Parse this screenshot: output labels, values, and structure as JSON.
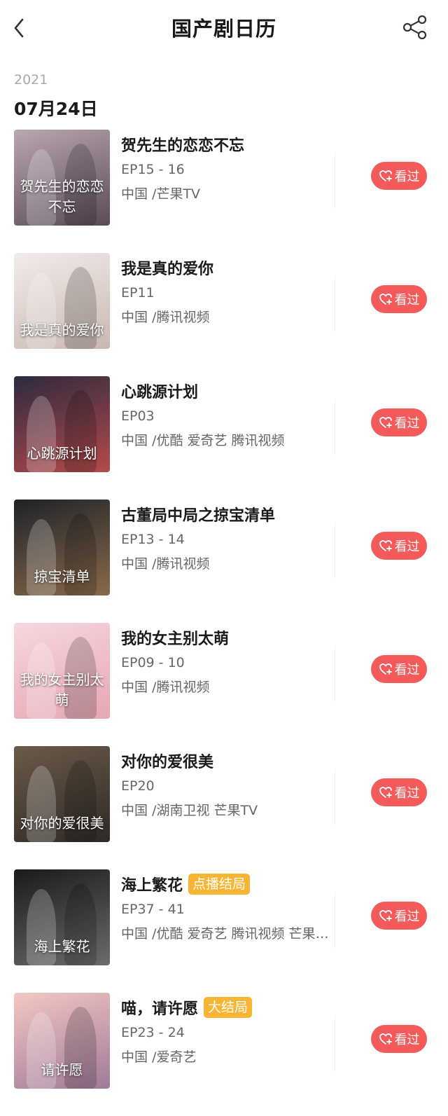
{
  "header": {
    "title": "国产剧日历"
  },
  "date_group": {
    "year": "2021",
    "date": "07月24日"
  },
  "button_label": "看过",
  "items": [
    {
      "name": "贺先生的恋恋不忘",
      "badge": "",
      "episode": "EP15 - 16",
      "platform": "中国 /芒果TV",
      "poster_text": "贺先生的恋恋不忘"
    },
    {
      "name": "我是真的爱你",
      "badge": "",
      "episode": "EP11",
      "platform": "中国 /腾讯视频",
      "poster_text": "我是真的爱你"
    },
    {
      "name": "心跳源计划",
      "badge": "",
      "episode": "EP03",
      "platform": "中国 /优酷 爱奇艺 腾讯视频",
      "poster_text": "心跳源计划"
    },
    {
      "name": "古董局中局之掠宝清单",
      "badge": "",
      "episode": "EP13 - 14",
      "platform": "中国 /腾讯视频",
      "poster_text": "掠宝清单"
    },
    {
      "name": "我的女主别太萌",
      "badge": "",
      "episode": "EP09 - 10",
      "platform": "中国 /腾讯视频",
      "poster_text": "我的女主别太萌"
    },
    {
      "name": "对你的爱很美",
      "badge": "",
      "episode": "EP20",
      "platform": "中国 /湖南卫视 芒果TV",
      "poster_text": "对你的爱很美"
    },
    {
      "name": "海上繁花",
      "badge": "点播结局",
      "episode": "EP37 - 41",
      "platform": "中国 /优酷 爱奇艺 腾讯视频 芒果TV",
      "poster_text": "海上繁花"
    },
    {
      "name": "喵，请许愿",
      "badge": "大结局",
      "episode": "EP23 - 24",
      "platform": "中国 /爱奇艺",
      "poster_text": "请许愿"
    }
  ],
  "poster_colors": [
    [
      "#b9a7b2",
      "#5a4b55"
    ],
    [
      "#f2ecea",
      "#c9b8b2"
    ],
    [
      "#2c2a3f",
      "#b54a4a"
    ],
    [
      "#1e2228",
      "#8a6a4a"
    ],
    [
      "#f6d8de",
      "#e7a6b3"
    ],
    [
      "#6b5a48",
      "#2e2a26"
    ],
    [
      "#1a1a1c",
      "#6b6b6b"
    ],
    [
      "#f3c8c2",
      "#a07a9a"
    ]
  ]
}
